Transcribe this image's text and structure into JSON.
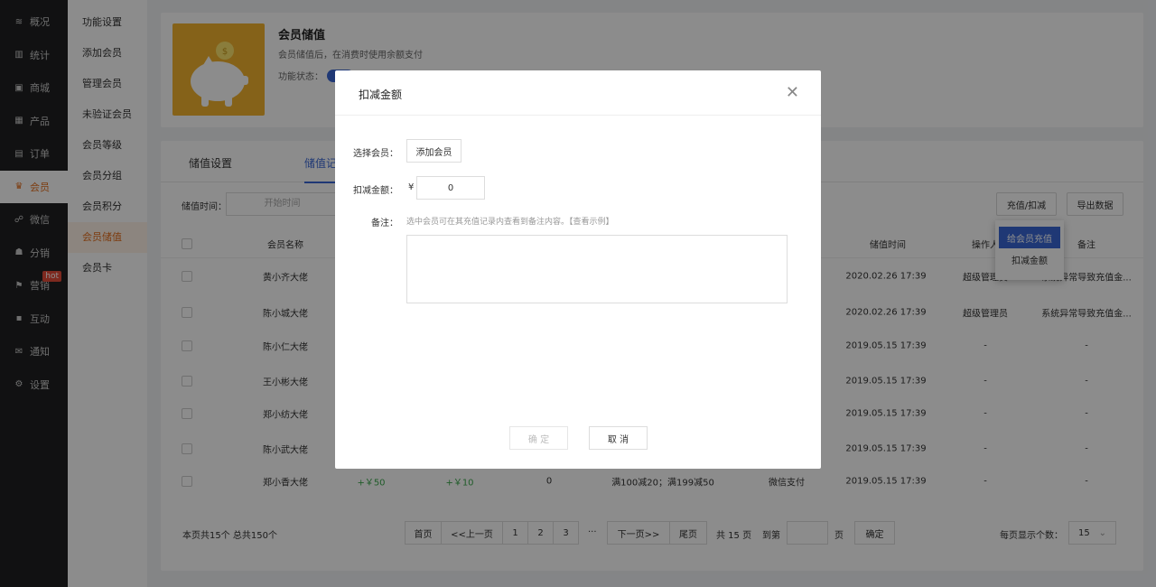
{
  "nav": {
    "items": [
      {
        "icon": "layers-icon",
        "glyph": "≋",
        "label": "概况"
      },
      {
        "icon": "chart-icon",
        "glyph": "▥",
        "label": "统计"
      },
      {
        "icon": "store-icon",
        "glyph": "▣",
        "label": "商城"
      },
      {
        "icon": "grid-icon",
        "glyph": "▦",
        "label": "产品"
      },
      {
        "icon": "order-icon",
        "glyph": "▤",
        "label": "订单"
      },
      {
        "icon": "crown-icon",
        "glyph": "♛",
        "label": "会员",
        "active": true
      },
      {
        "icon": "wechat-icon",
        "glyph": "☍",
        "label": "微信"
      },
      {
        "icon": "distribution-icon",
        "glyph": "☗",
        "label": "分销"
      },
      {
        "icon": "flag-icon",
        "glyph": "⚑",
        "label": "营销",
        "badge": "hot"
      },
      {
        "icon": "apps-icon",
        "glyph": "▪",
        "label": "互动"
      },
      {
        "icon": "mail-icon",
        "glyph": "✉",
        "label": "通知"
      },
      {
        "icon": "settings-icon",
        "glyph": "⚙",
        "label": "设置"
      }
    ]
  },
  "subnav": {
    "items": [
      "功能设置",
      "添加会员",
      "管理会员",
      "未验证会员",
      "会员等级",
      "会员分组",
      "会员积分",
      "会员储值",
      "会员卡"
    ],
    "active_index": 7
  },
  "feature": {
    "title": "会员储值",
    "desc": "会员储值后，在消费时使用余额支付",
    "status_label": "功能状态：",
    "status_on": true
  },
  "tabs": [
    "储值设置",
    "储值记"
  ],
  "filter": {
    "label": "储值时间：",
    "start_placeholder": "开始时间"
  },
  "actions": {
    "recharge_deduct": "充值/扣减",
    "export": "导出数据"
  },
  "dropdown": {
    "items": [
      "给会员充值",
      "扣减金额"
    ]
  },
  "table": {
    "headers": {
      "name": "会员名称",
      "time": "储值时间",
      "operator": "操作人",
      "remark": "备注"
    },
    "rows": [
      {
        "name": "黄小齐大佬",
        "time": "2020.02.26  17:39",
        "operator": "超级管理员",
        "remark": "系统异常导致充值金..."
      },
      {
        "name": "陈小城大佬",
        "time": "2020.02.26  17:39",
        "operator": "超级管理员",
        "remark": "系统异常导致充值金..."
      },
      {
        "name": "陈小仁大佬",
        "time": "2019.05.15  17:39",
        "operator": "-",
        "remark": "-"
      },
      {
        "name": "王小彬大佬",
        "time": "2019.05.15  17:39",
        "operator": "-",
        "remark": "-"
      },
      {
        "name": "郑小纺大佬",
        "time": "2019.05.15  17:39",
        "operator": "-",
        "remark": "-"
      },
      {
        "name": "陈小武大佬",
        "time": "2019.05.15  17:39",
        "operator": "-",
        "remark": "-"
      },
      {
        "name": "郑小香大佬",
        "amount1": "+￥50",
        "amount2": "+￥10",
        "count": "0",
        "promo": "满100减20；满199减50",
        "pay": "微信支付",
        "time": "2019.05.15  17:39",
        "operator": "-",
        "remark": "-"
      }
    ]
  },
  "pager": {
    "summary": "本页共15个 总共150个",
    "first": "首页",
    "prev": "<<上一页",
    "pages": [
      "1",
      "2",
      "3"
    ],
    "ellipsis": "···",
    "next": "下一页>>",
    "last": "尾页",
    "total": "共 15 页",
    "goto": "到第",
    "page_unit": "页",
    "confirm": "确定",
    "per_page_label": "每页显示个数：",
    "per_page": "15"
  },
  "modal": {
    "title": "扣减金额",
    "member_label": "选择会员：",
    "add_member": "添加会员",
    "amount_label": "扣减金额：",
    "currency": "¥",
    "amount": "0",
    "remark_label": "备注：",
    "remark_tip": "选中会员可在其充值记录内查看到备注内容。【查看示例】",
    "confirm": "确 定",
    "cancel": "取 消"
  }
}
